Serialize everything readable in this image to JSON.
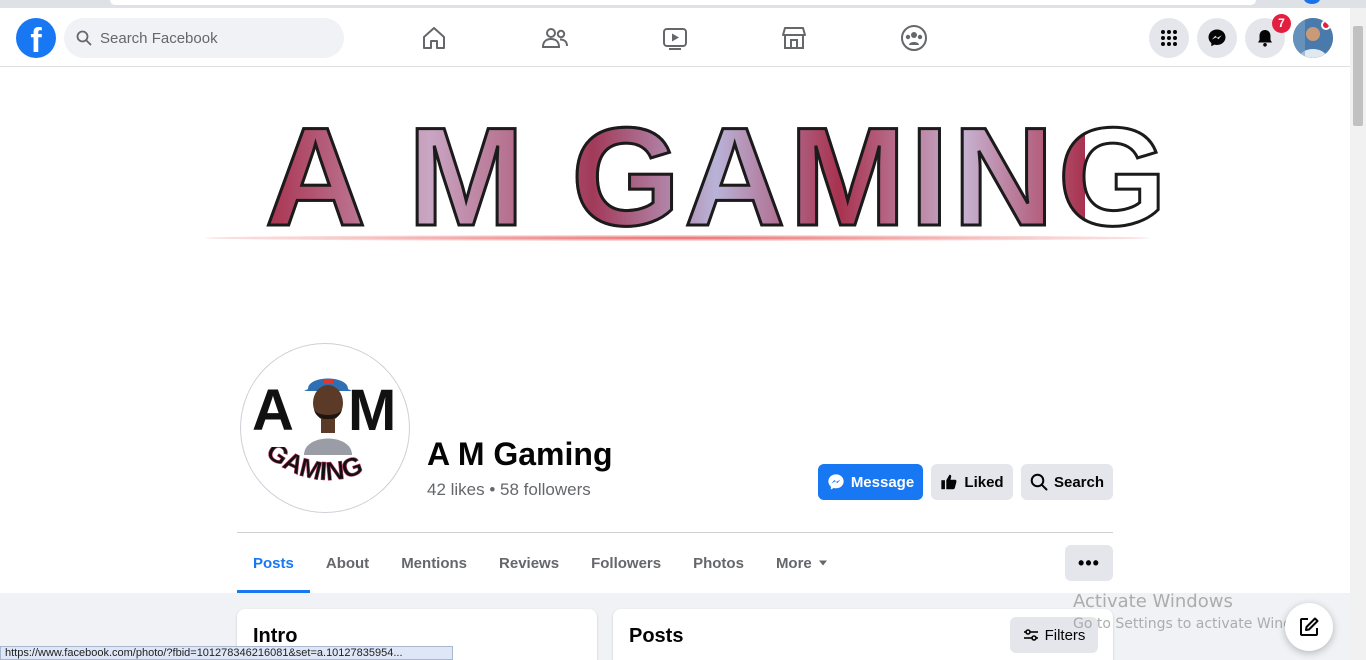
{
  "topnav": {
    "logo": "f",
    "search_placeholder": "Search Facebook",
    "nav_icons": [
      "home-icon",
      "friends-icon",
      "watch-icon",
      "marketplace-icon",
      "groups-icon"
    ],
    "notifications_count": "7"
  },
  "cover": {
    "title": "A M GAMING"
  },
  "profile": {
    "pic_letters": {
      "a": "A",
      "m": "M",
      "word": "GAMING"
    },
    "name": "A M Gaming",
    "stats": "42 likes • 58 followers"
  },
  "actions": {
    "message": "Message",
    "liked": "Liked",
    "search": "Search"
  },
  "tabs": [
    {
      "label": "Posts",
      "active": true
    },
    {
      "label": "About"
    },
    {
      "label": "Mentions"
    },
    {
      "label": "Reviews"
    },
    {
      "label": "Followers"
    },
    {
      "label": "Photos"
    },
    {
      "label": "More"
    }
  ],
  "more_menu": "•••",
  "cards": {
    "intro_title": "Intro",
    "posts_title": "Posts",
    "filters": "Filters"
  },
  "watermark": {
    "line1": "Activate Windows",
    "line2": "Go to Settings to activate Windows."
  },
  "status_url": "https://www.facebook.com/photo/?fbid=101278346216081&set=a.10127835954...",
  "colors": {
    "brand": "#1877f2",
    "badge": "#e41e3f"
  }
}
